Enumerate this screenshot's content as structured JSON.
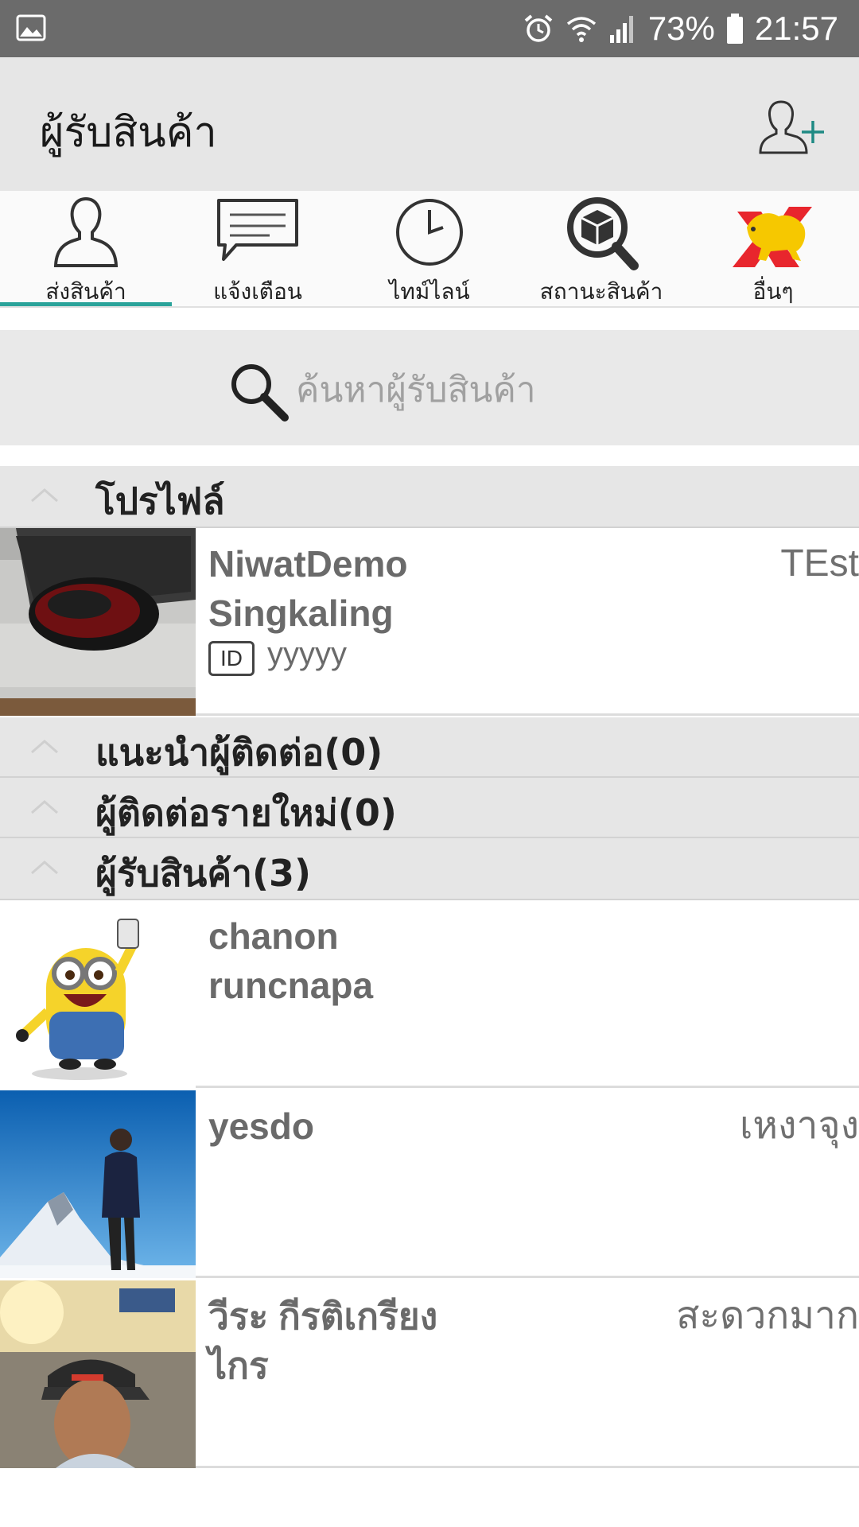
{
  "status_bar": {
    "battery": "73%",
    "time": "21:57",
    "icons": [
      "gallery-icon",
      "alarm-icon",
      "wifi-icon",
      "signal-icon",
      "battery-icon"
    ]
  },
  "app_bar": {
    "title": "ผู้รับสินค้า",
    "action_icon": "add-contact-icon"
  },
  "tabs": [
    {
      "label": "ส่งสินค้า",
      "icon": "person-icon",
      "active": true
    },
    {
      "label": "แจ้งเตือน",
      "icon": "message-icon",
      "active": false
    },
    {
      "label": "ไทม์ไลน์",
      "icon": "clock-icon",
      "active": false
    },
    {
      "label": "สถานะสินค้า",
      "icon": "package-search-icon",
      "active": false
    },
    {
      "label": "อื่นๆ",
      "icon": "lion-logo-icon",
      "active": false
    }
  ],
  "search": {
    "placeholder": "ค้นหาผู้รับสินค้า"
  },
  "sections": {
    "profile": "โปรไฟล์",
    "suggested": "แนะนำผู้ติดต่อ(0)",
    "new_contacts": "ผู้ติดต่อรายใหม่(0)",
    "recipients": "ผู้รับสินค้า(3)"
  },
  "profile": {
    "name": "NiwatDemo\nSingkaling",
    "status": "TEst",
    "id_label": "ID",
    "id_value": "yyyyy"
  },
  "recipients": [
    {
      "name": "chanon\nruncnapa",
      "status": ""
    },
    {
      "name": "yesdo",
      "status": "เหงาจุง"
    },
    {
      "name": "วีระ  กีรติเกรียง\nไกร",
      "status": "สะดวกมาก"
    }
  ],
  "colors": {
    "status_bar": "#6b6b6b",
    "app_bar": "#e6e6e6",
    "accent": "#2aa39a",
    "add_icon_plus": "#1f8a84"
  }
}
